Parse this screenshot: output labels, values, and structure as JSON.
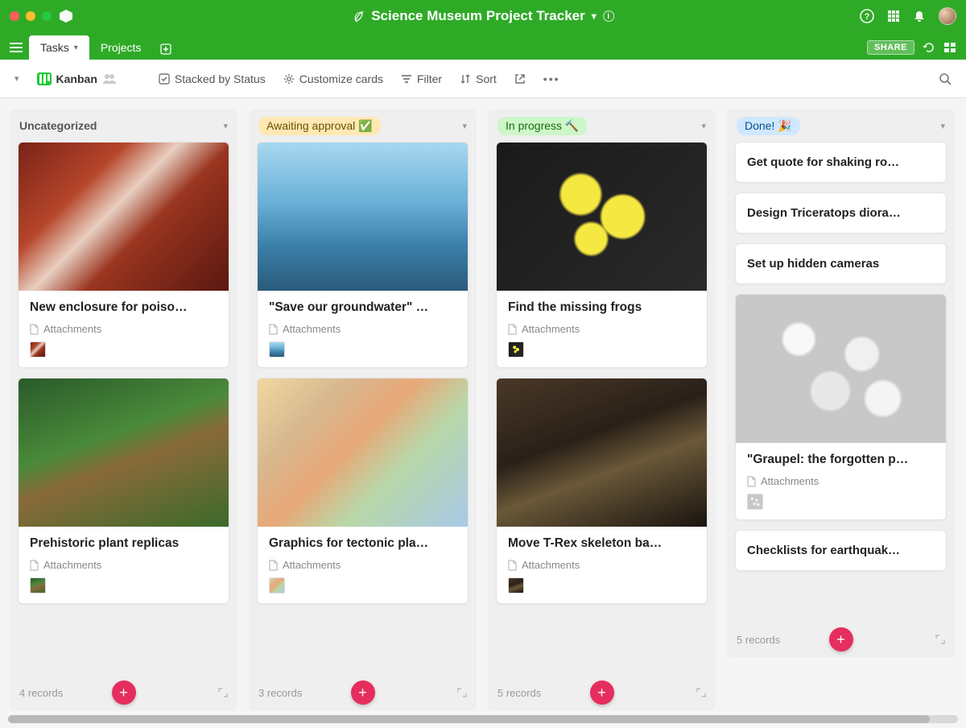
{
  "window": {
    "title": "Science Museum Project Tracker"
  },
  "tabs": {
    "tasks": "Tasks",
    "projects": "Projects"
  },
  "share_label": "SHARE",
  "toolbar": {
    "view_name": "Kanban",
    "stacked": "Stacked by Status",
    "customize": "Customize cards",
    "filter": "Filter",
    "sort": "Sort"
  },
  "attachments_label": "Attachments",
  "columns": [
    {
      "title": "Uncategorized",
      "badge_class": "",
      "footer": "4 records",
      "cards": [
        {
          "title": "New enclosure for poiso…",
          "img": "img-frog1",
          "thumb": "img-frog1",
          "has_att": true
        },
        {
          "title": "Prehistoric plant replicas",
          "img": "img-plant",
          "thumb": "img-plant",
          "has_att": true
        }
      ]
    },
    {
      "title": "Awaiting approval ✅",
      "badge_class": "badge-yellow",
      "footer": "3 records",
      "cards": [
        {
          "title": "\"Save our groundwater\" …",
          "img": "img-water",
          "thumb": "img-water",
          "has_att": true
        },
        {
          "title": "Graphics for tectonic pla…",
          "img": "img-map",
          "thumb": "img-map",
          "has_att": true
        }
      ]
    },
    {
      "title": "In progress 🔨",
      "badge_class": "badge-green",
      "footer": "5 records",
      "cards": [
        {
          "title": "Find the missing frogs",
          "img": "img-frog2",
          "thumb": "img-frog2",
          "has_att": true
        },
        {
          "title": "Move T-Rex skeleton ba…",
          "img": "img-trex",
          "thumb": "img-trex",
          "has_att": true
        }
      ]
    },
    {
      "title": "Done! 🎉",
      "badge_class": "badge-blue",
      "footer": "5 records",
      "cards": [
        {
          "title": "Get quote for shaking ro…",
          "simple": true
        },
        {
          "title": "Design Triceratops diora…",
          "simple": true
        },
        {
          "title": "Set up hidden cameras",
          "simple": true
        },
        {
          "title": "\"Graupel: the forgotten p…",
          "img": "img-graupel",
          "thumb": "img-graupel",
          "has_att": true
        },
        {
          "title": "Checklists for earthquak…",
          "simple": true
        }
      ]
    }
  ]
}
